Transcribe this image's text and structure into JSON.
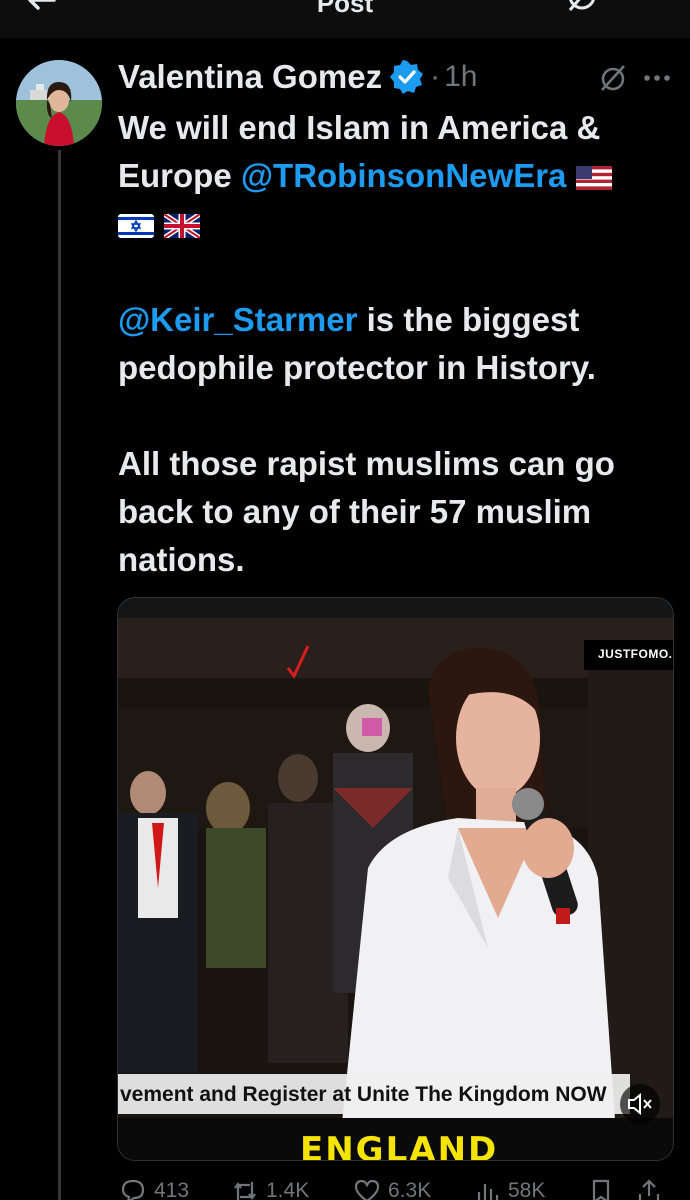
{
  "topbar": {
    "title": "Post",
    "back_icon": "arrow-left-icon",
    "grok_icon": "grok-icon",
    "more_icon": "more-horizontal-icon"
  },
  "post": {
    "display_name": "Valentina Gomez",
    "verified_icon": "verified-badge-icon",
    "separator": "·",
    "time": "1h",
    "text": {
      "line1": "We will end Islam in America &",
      "line2_a": "Europe ",
      "line2_mention": "@TRobinsonNewEra",
      "flags": [
        "flag-us-icon",
        "flag-israel-icon",
        "flag-uk-icon"
      ],
      "para2_mention": "@Keir_Starmer",
      "para2_line1_rest": " is the biggest",
      "para2_line2": "pedophile protector in History.",
      "para3_line1": "All those rapist muslims can go",
      "para3_line2": "back to any of their 57 muslim",
      "para3_line3": "nations."
    },
    "media": {
      "watermark": "JUSTFOMO.COM",
      "ticker": "vement and Register at Unite The Kingdom NOW",
      "caption": "ENGLAND",
      "mute_icon": "volume-muted-icon"
    },
    "actions": {
      "replies": "413",
      "reposts": "1.4K",
      "likes": "6.3K",
      "views": "58K"
    }
  },
  "colors": {
    "background": "#000000",
    "text": "#e7e9ea",
    "muted": "#71767b",
    "link": "#1d9bf0",
    "verified": "#1d9bf0"
  }
}
